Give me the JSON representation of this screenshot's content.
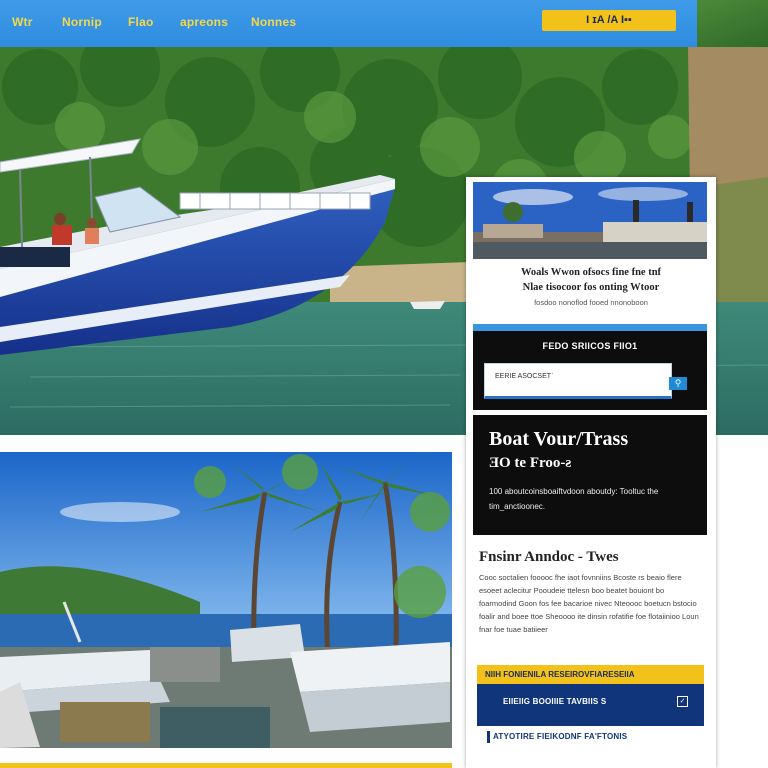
{
  "nav": {
    "items": [
      "Wtr",
      "Nornip",
      "Flao",
      "apreons",
      "Nonnes"
    ],
    "cta_label": "I ɪA /A I▪▪"
  },
  "sidebar": {
    "heading_line1": "Woals Wwon ofsocs fine fne tnf",
    "heading_line2": "Nlae tisocoor fos onting Wtoor",
    "subtext": "fosdoo nonoflod fooed nnonoboon",
    "search": {
      "title": "FEDO SRIICOS FIIO1",
      "input_value": "EERIE ASOCSETˈ",
      "button_icon": "search-icon"
    },
    "promo": {
      "title": "Boat Vour/Trass",
      "subtitle": "ƎO te Froo-ƨ",
      "text": "100 aboutcoinsboaiftvdoon aboutdy: Tooltuc the tim_anctioonec."
    },
    "section_title": "Fnsinr Anndoc - Twes",
    "section_body": "Cooc soctalien fooooc fhe iaot fovnniins Bcoste rs beaio flere esoeet aclecitur Pooudeie ttelesn boo beatet bouiont bo foarmodind Goon fos fee bacarioe nivec Nteoooc boetucn bstocio foalir and boee ttoe Sheoooo ite dinsin rofatifie foe flotaiinioo Loun fnar foe tuae batiieer",
    "yellow_bar": "NIIH FONIENILA RESEIROVFIARESEIIA",
    "navy_top": "EIIEIIG BOOIIIE TAVBIIS S",
    "navy_bottom": "ATYOTIRE FIEIKODNF FA'FTONIS"
  },
  "colors": {
    "nav_blue": "#3399e6",
    "accent_yellow": "#f2c21b",
    "navy": "#10357a"
  }
}
